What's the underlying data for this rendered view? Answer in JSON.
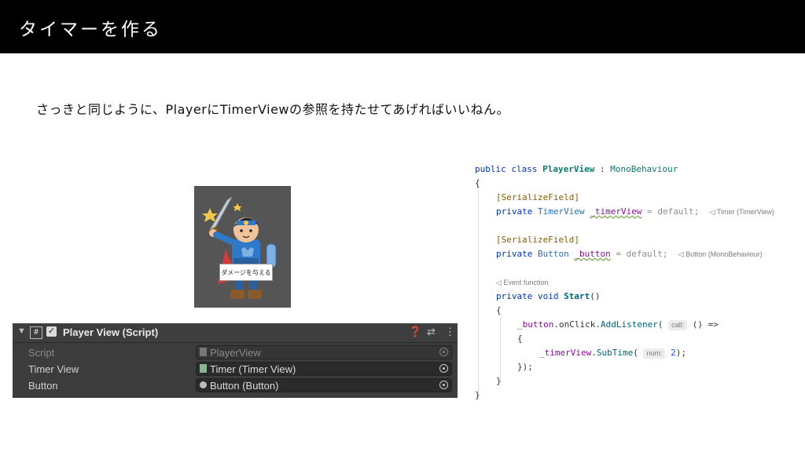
{
  "header": {
    "title": "タイマーを作る"
  },
  "description": "さっきと同じように、PlayerにTimerViewの参照を持たせてあげればいいねん。",
  "illustration": {
    "caption": "ダメージを与える"
  },
  "inspector": {
    "component_title": "Player View (Script)",
    "icons": {
      "help": "help-icon",
      "settings": "sliders-icon",
      "menu": "more-vertical-icon"
    },
    "rows": [
      {
        "label": "Script",
        "value": "PlayerView",
        "disabled": true
      },
      {
        "label": "Timer View",
        "value": "Timer (Timer View)",
        "disabled": false
      },
      {
        "label": "Button",
        "value": "Button (Button)",
        "disabled": false
      }
    ]
  },
  "code": {
    "line1": {
      "kw": "public class ",
      "cls": "PlayerView",
      "sep": " : ",
      "base": "MonoBehaviour"
    },
    "open_brace": "{",
    "close_brace": "}",
    "serialize_field": "[SerializeField]",
    "field1": {
      "kw": "private ",
      "type": "TimerView ",
      "name": "_timerView",
      "rest": " = default;",
      "hint": "◁ Timer (TimerView)"
    },
    "field2": {
      "kw": "private ",
      "type": "Button ",
      "name": "_button",
      "rest": " = default;",
      "hint": "◁ Button (MonoBehaviour)"
    },
    "event_hint": "◁ Event function",
    "start_sig": {
      "kw": "private void ",
      "name": "Start",
      "rest": "()"
    },
    "listener": {
      "obj": "_button",
      "chain": ".onClick.",
      "method": "AddListener",
      "open": "(",
      "param": "call:",
      "rest": " () =>"
    },
    "subtime": {
      "obj": "_timerView",
      "dot": ".",
      "method": "SubTime",
      "open": "(",
      "param": "num:",
      "value": "2",
      "close": ");"
    },
    "close_lambda": "});"
  }
}
